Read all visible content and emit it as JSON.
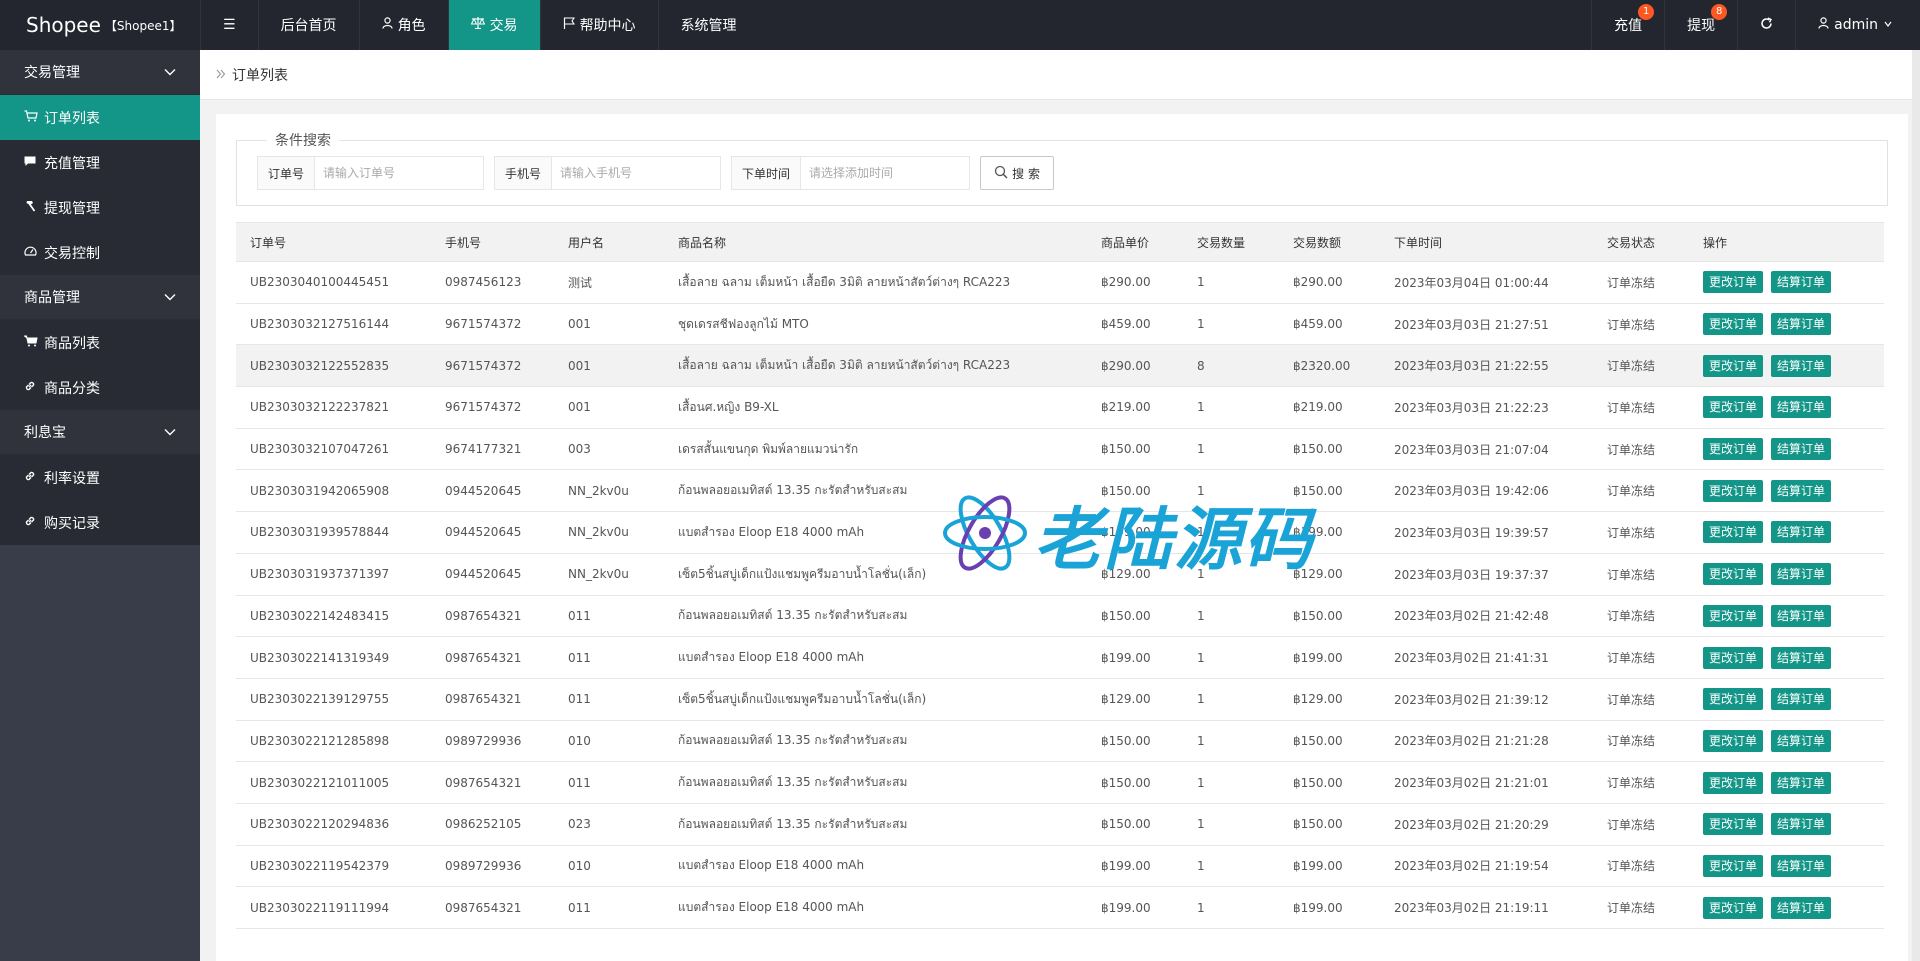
{
  "logo": {
    "brand": "Shopee",
    "sub": "【Shopee1】"
  },
  "topnav": {
    "menu_toggle": "☰",
    "items": [
      {
        "label": "后台首页",
        "icon": ""
      },
      {
        "label": "角色",
        "icon": "person-icon"
      },
      {
        "label": "交易",
        "icon": "balance-icon"
      },
      {
        "label": "帮助中心",
        "icon": "flag-icon"
      },
      {
        "label": "系统管理",
        "icon": ""
      }
    ],
    "right": [
      {
        "label": "充值",
        "badge": "1"
      },
      {
        "label": "提现",
        "badge": "8"
      }
    ],
    "user": "admin"
  },
  "sidebar": {
    "groups": [
      {
        "label": "交易管理",
        "items": [
          "订单列表",
          "充值管理",
          "提现管理",
          "交易控制"
        ]
      },
      {
        "label": "商品管理",
        "items": [
          "商品列表",
          "商品分类"
        ]
      },
      {
        "label": "利息宝",
        "items": [
          "利率设置",
          "购买记录"
        ]
      }
    ]
  },
  "breadcrumb": "订单列表",
  "search": {
    "legend": "条件搜索",
    "order_label": "订单号",
    "order_placeholder": "请输入订单号",
    "phone_label": "手机号",
    "phone_placeholder": "请输入手机号",
    "time_label": "下单时间",
    "time_placeholder": "请选择添加时间",
    "button": "搜 索"
  },
  "table": {
    "headers": [
      "订单号",
      "手机号",
      "用户名",
      "商品名称",
      "商品单价",
      "交易数量",
      "交易数额",
      "下单时间",
      "交易状态",
      "操作"
    ],
    "action_edit": "更改订单",
    "action_settle": "结算订单",
    "rows": [
      [
        "UB2303040100445451",
        "0987456123",
        "测试",
        "เสื้อลาย ฉลาม เต็มหน้า เสื้อยืด 3มิติ ลายหน้าสัตว์ต่างๆ RCA223",
        "฿290.00",
        "1",
        "฿290.00",
        "2023年03月04日 01:00:44",
        "订单冻结"
      ],
      [
        "UB2303032127516144",
        "9671574372",
        "001",
        "ชุดเดรสชีฟองลูกไม้ MTO",
        "฿459.00",
        "1",
        "฿459.00",
        "2023年03月03日 21:27:51",
        "订单冻结"
      ],
      [
        "UB2303032122552835",
        "9671574372",
        "001",
        "เสื้อลาย ฉลาม เต็มหน้า เสื้อยืด 3มิติ ลายหน้าสัตว์ต่างๆ RCA223",
        "฿290.00",
        "8",
        "฿2320.00",
        "2023年03月03日 21:22:55",
        "订单冻结"
      ],
      [
        "UB2303032122237821",
        "9671574372",
        "001",
        "เสื้อนศ.หญิง B9-XL",
        "฿219.00",
        "1",
        "฿219.00",
        "2023年03月03日 21:22:23",
        "订单冻结"
      ],
      [
        "UB2303032107047261",
        "9674177321",
        "003",
        "เดรสสั้นแขนกุด พิมพ์ลายแมวน่ารัก",
        "฿150.00",
        "1",
        "฿150.00",
        "2023年03月03日 21:07:04",
        "订单冻结"
      ],
      [
        "UB2303031942065908",
        "0944520645",
        "NN_2kv0u",
        "ก้อนพลอยอเมทิสต์ 13.35 กะรัตสำหรับสะสม",
        "฿150.00",
        "1",
        "฿150.00",
        "2023年03月03日 19:42:06",
        "订单冻结"
      ],
      [
        "UB2303031939578844",
        "0944520645",
        "NN_2kv0u",
        "แบตสำรอง Eloop E18 4000 mAh",
        "฿199.00",
        "1",
        "฿199.00",
        "2023年03月03日 19:39:57",
        "订单冻结"
      ],
      [
        "UB2303031937371397",
        "0944520645",
        "NN_2kv0u",
        "เซ็ต5ชิ้นสบู่เด็กแป้งแชมพูครีมอาบน้ำโลชั่น(เล็ก)",
        "฿129.00",
        "1",
        "฿129.00",
        "2023年03月03日 19:37:37",
        "订单冻结"
      ],
      [
        "UB2303022142483415",
        "0987654321",
        "011",
        "ก้อนพลอยอเมทิสต์ 13.35 กะรัตสำหรับสะสม",
        "฿150.00",
        "1",
        "฿150.00",
        "2023年03月02日 21:42:48",
        "订单冻结"
      ],
      [
        "UB2303022141319349",
        "0987654321",
        "011",
        "แบตสำรอง Eloop E18 4000 mAh",
        "฿199.00",
        "1",
        "฿199.00",
        "2023年03月02日 21:41:31",
        "订单冻结"
      ],
      [
        "UB2303022139129755",
        "0987654321",
        "011",
        "เซ็ต5ชิ้นสบู่เด็กแป้งแชมพูครีมอาบน้ำโลชั่น(เล็ก)",
        "฿129.00",
        "1",
        "฿129.00",
        "2023年03月02日 21:39:12",
        "订单冻结"
      ],
      [
        "UB2303022121285898",
        "0989729936",
        "010",
        "ก้อนพลอยอเมทิสต์ 13.35 กะรัตสำหรับสะสม",
        "฿150.00",
        "1",
        "฿150.00",
        "2023年03月02日 21:21:28",
        "订单冻结"
      ],
      [
        "UB2303022121011005",
        "0987654321",
        "011",
        "ก้อนพลอยอเมทิสต์ 13.35 กะรัตสำหรับสะสม",
        "฿150.00",
        "1",
        "฿150.00",
        "2023年03月02日 21:21:01",
        "订单冻结"
      ],
      [
        "UB2303022120294836",
        "0986252105",
        "023",
        "ก้อนพลอยอเมทิสต์ 13.35 กะรัตสำหรับสะสม",
        "฿150.00",
        "1",
        "฿150.00",
        "2023年03月02日 21:20:29",
        "订单冻结"
      ],
      [
        "UB2303022119542379",
        "0989729936",
        "010",
        "แบตสำรอง Eloop E18 4000 mAh",
        "฿199.00",
        "1",
        "฿199.00",
        "2023年03月02日 21:19:54",
        "订单冻结"
      ],
      [
        "UB2303022119111994",
        "0987654321",
        "011",
        "แบตสำรอง Eloop E18 4000 mAh",
        "฿199.00",
        "1",
        "฿199.00",
        "2023年03月02日 21:19:11",
        "订单冻结"
      ]
    ]
  },
  "watermark": "老陆源码",
  "colors": {
    "accent": "#139688",
    "header": "#23262e",
    "sidebar": "#393d49",
    "badge": "#ff5722"
  }
}
